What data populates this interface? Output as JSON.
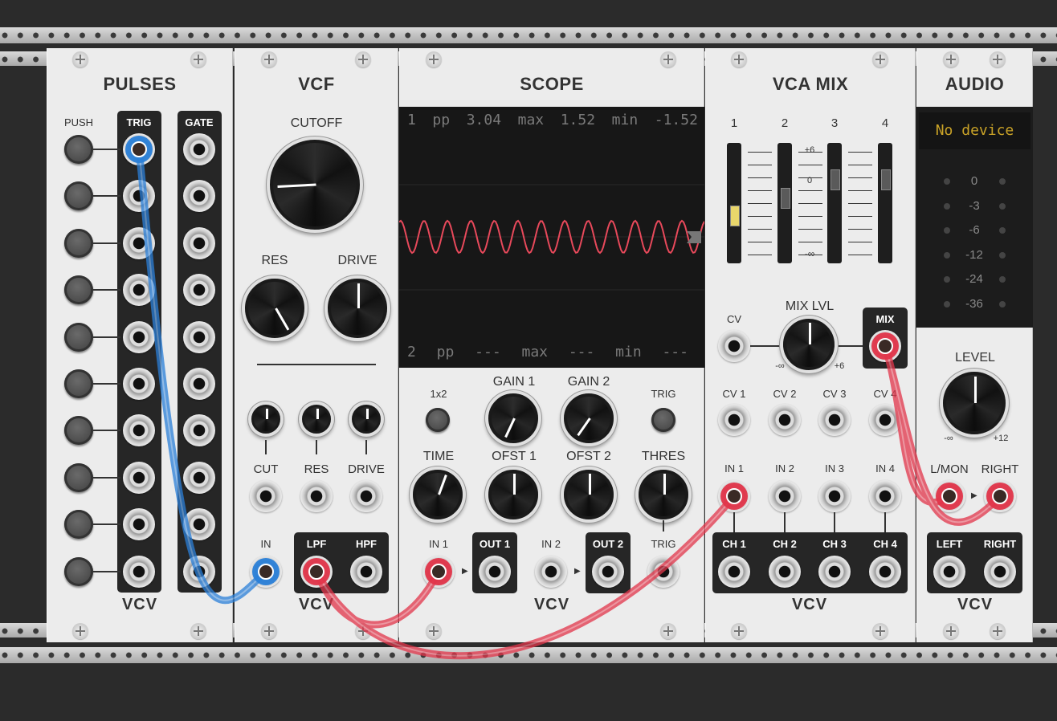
{
  "modules": {
    "pulses": {
      "title": "PULSES",
      "col_push": "PUSH",
      "col_trig": "TRIG",
      "col_gate": "GATE",
      "logo": "VCV"
    },
    "vcf": {
      "title": "VCF",
      "cutoff": "CUTOFF",
      "res": "RES",
      "drive": "DRIVE",
      "cv_cut": "CUT",
      "cv_res": "RES",
      "cv_drive": "DRIVE",
      "in": "IN",
      "lpf": "LPF",
      "hpf": "HPF",
      "logo": "VCV"
    },
    "scope": {
      "title": "SCOPE",
      "readout1": {
        "ch": "1",
        "pp_label": "pp",
        "pp": "3.04",
        "max_label": "max",
        "max": "1.52",
        "min_label": "min",
        "min": "-1.52"
      },
      "readout2": {
        "ch": "2",
        "pp_label": "pp",
        "pp": "---",
        "max_label": "max",
        "max": "---",
        "min_label": "min",
        "min": "---"
      },
      "btn_1x2": "1x2",
      "gain1": "GAIN 1",
      "gain2": "GAIN 2",
      "trig_btn": "TRIG",
      "time": "TIME",
      "ofst1": "OFST 1",
      "ofst2": "OFST 2",
      "thres": "THRES",
      "in1": "IN 1",
      "out1": "OUT 1",
      "in2": "IN 2",
      "out2": "OUT 2",
      "trig_in": "TRIG",
      "logo": "VCV",
      "trace_color": "#e8495b"
    },
    "vcamix": {
      "title": "VCA MIX",
      "faders": [
        "1",
        "2",
        "3",
        "4"
      ],
      "fader_scale_top": "+6",
      "fader_scale_mid": "0",
      "fader_scale_bot": "-∞",
      "cv": "CV",
      "mix_lvl": "MIX LVL",
      "mix_lvl_min": "-∞",
      "mix_lvl_max": "+6",
      "mix": "MIX",
      "cv_inputs": [
        "CV 1",
        "CV 2",
        "CV 3",
        "CV 4"
      ],
      "inputs": [
        "IN 1",
        "IN 2",
        "IN 3",
        "IN 4"
      ],
      "outputs": [
        "CH 1",
        "CH 2",
        "CH 3",
        "CH 4"
      ],
      "logo": "VCV"
    },
    "audio": {
      "title": "AUDIO",
      "device": "No device",
      "meter": [
        "0",
        "-3",
        "-6",
        "-12",
        "-24",
        "-36"
      ],
      "level": "LEVEL",
      "level_min": "-∞",
      "level_max": "+12",
      "lmon": "L/MON",
      "right_in": "RIGHT",
      "left_out": "LEFT",
      "right_out": "RIGHT",
      "logo": "VCV",
      "device_color": "#c9a227"
    }
  },
  "colors": {
    "cable_blue": "#2a7fd8",
    "cable_red": "#e2354a"
  }
}
